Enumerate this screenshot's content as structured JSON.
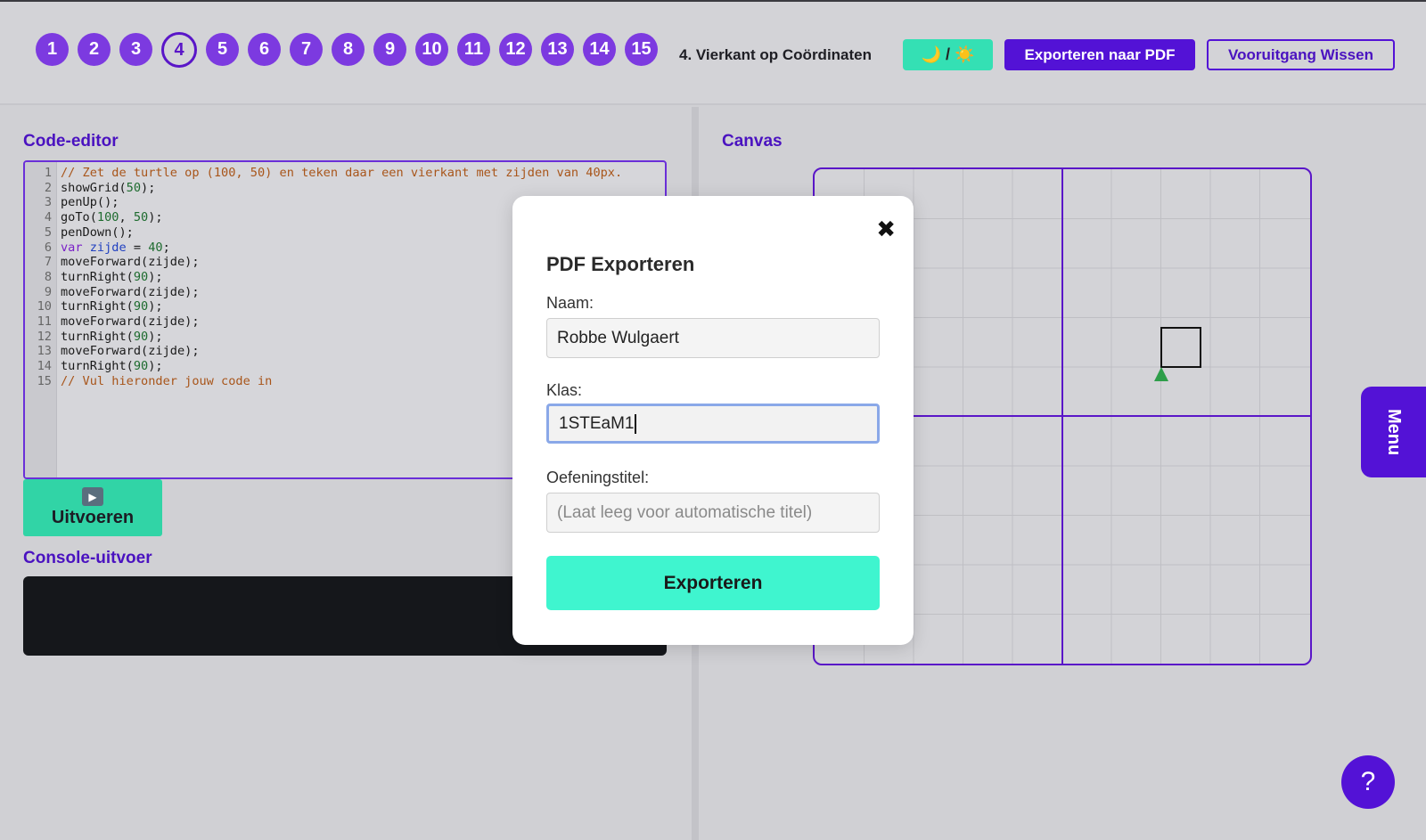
{
  "levels": [
    "1",
    "2",
    "3",
    "4",
    "5",
    "6",
    "7",
    "8",
    "9",
    "10",
    "11",
    "12",
    "13",
    "14",
    "15"
  ],
  "active_level": "4",
  "header": {
    "exercise_title": "4. Vierkant op Coördinaten",
    "theme_toggle": "🌙 / ☀️",
    "export_label": "Exporteren naar PDF",
    "reset_label": "Vooruitgang Wissen"
  },
  "editor": {
    "title": "Code-editor",
    "line_numbers": [
      "1",
      "2",
      "3",
      "4",
      "5",
      "6",
      "7",
      "8",
      "9",
      "10",
      "11",
      "12",
      "13",
      "14",
      "15"
    ],
    "lines": [
      "// Zet de turtle op (100, 50) en teken daar een vierkant met zijden van 40px.",
      "showGrid(50);",
      "penUp();",
      "goTo(100, 50);",
      "penDown();",
      "var zijde = 40;",
      "moveForward(zijde);",
      "turnRight(90);",
      "moveForward(zijde);",
      "turnRight(90);",
      "moveForward(zijde);",
      "turnRight(90);",
      "moveForward(zijde);",
      "turnRight(90);",
      "// Vul hieronder jouw code in"
    ]
  },
  "run_button": {
    "icon": "play-icon",
    "label": "Uitvoeren"
  },
  "console": {
    "title": "Console-uitvoer"
  },
  "canvas": {
    "title": "Canvas"
  },
  "side_menu": {
    "label": "Menu"
  },
  "help": {
    "label": "?"
  },
  "modal": {
    "title": "PDF Exporteren",
    "close": "✖",
    "name_label": "Naam:",
    "name_value": "Robbe Wulgaert",
    "class_label": "Klas:",
    "class_value": "1STEaM1",
    "exercise_label": "Oefeningstitel:",
    "exercise_placeholder": "(Laat leeg voor automatische titel)",
    "submit_label": "Exporteren"
  },
  "colors": {
    "accent": "#5312d6",
    "run": "#31d4a6",
    "export_submit": "#3ff5cf",
    "turtle": "#2e9e4a"
  }
}
